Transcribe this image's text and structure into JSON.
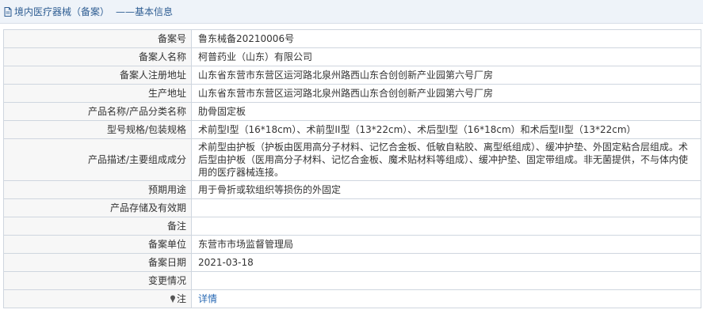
{
  "header": {
    "title": "境内医疗器械（备案）",
    "subtitle": "——基本信息",
    "accent_color": "#2f5e93",
    "icon": "document-icon"
  },
  "rows": [
    {
      "label": "备案号",
      "value": "鲁东械备20210006号"
    },
    {
      "label": "备案人名称",
      "value": "柯普药业（山东）有限公司"
    },
    {
      "label": "备案人注册地址",
      "value": "山东省东营市东营区运河路北泉州路西山东合创创新产业园第六号厂房"
    },
    {
      "label": "生产地址",
      "value": "山东省东营市东营区运河路北泉州路西山东合创创新产业园第六号厂房"
    },
    {
      "label": "产品名称/产品分类名称",
      "value": "肋骨固定板"
    },
    {
      "label": "型号规格/包装规格",
      "value": "术前型I型（16*18cm）、术前型II型（13*22cm）、术后型I型（16*18cm）和术后型II型（13*22cm）"
    },
    {
      "label": "产品描述/主要组成成分",
      "value": "术前型由护板（护板由医用高分子材料、记忆合金板、低敏自粘胶、离型纸组成）、缓冲护垫、外固定粘合层组成。术后型由护板（医用高分子材料、记忆合金板、魔术贴材料等组成）、缓冲护垫、固定带组成。非无菌提供，不与体内使用的医疗器械连接。"
    },
    {
      "label": "预期用途",
      "value": "用于骨折或软组织等损伤的外固定"
    },
    {
      "label": "产品存储及有效期",
      "value": ""
    },
    {
      "label": "备注",
      "value": ""
    },
    {
      "label": "备案单位",
      "value": "东营市市场监督管理局"
    },
    {
      "label": "备案日期",
      "value": "2021-03-18"
    },
    {
      "label": "变更情况",
      "value": ""
    }
  ],
  "note": {
    "label": "注",
    "icon": "pin-icon",
    "link_text": "详情",
    "link_color": "#2a6ab4"
  }
}
